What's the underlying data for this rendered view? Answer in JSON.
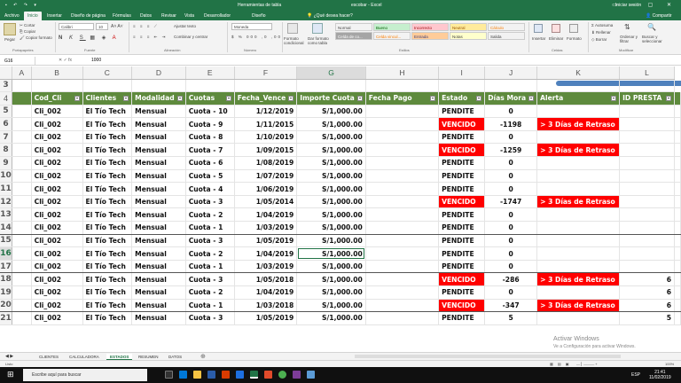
{
  "title_bar": {
    "text1": "Herramientas de tabla",
    "text2": "escobar - Excel",
    "signin": "Iniciar sesión"
  },
  "tabs": [
    "Archivo",
    "Inicio",
    "Insertar",
    "Diseño de página",
    "Fórmulas",
    "Datos",
    "Revisar",
    "Vista",
    "Desarrollador",
    "Diseño"
  ],
  "active_tab": "Inicio",
  "tell_me": "¿Qué desea hacer?",
  "share": "Compartir",
  "ribbon": {
    "clipboard": {
      "paste": "Pegar",
      "cut": "Cortar",
      "copy": "Copiar",
      "format": "Copiar formato",
      "label": "Portapapeles"
    },
    "font": {
      "name": "Calibri",
      "size": "10",
      "label": "Fuente"
    },
    "alignment": {
      "wrap": "Ajustar texto",
      "merge": "Combinar y centrar",
      "label": "Alineación"
    },
    "number": {
      "format": "Moneda",
      "label": "Número"
    },
    "styles": {
      "conditional": "Formato condicional",
      "table": "Dar formato como tabla",
      "cells": [
        {
          "label": "Normal",
          "bg": "#ffffff",
          "color": "#000000"
        },
        {
          "label": "Bueno",
          "bg": "#c6efce",
          "color": "#006100"
        },
        {
          "label": "Incorrecto",
          "bg": "#ffc7ce",
          "color": "#9c0006"
        },
        {
          "label": "Neutral",
          "bg": "#ffeb9c",
          "color": "#9c5700"
        },
        {
          "label": "Cálculo",
          "bg": "#f2f2f2",
          "color": "#fa7d00"
        },
        {
          "label": "Celda de co...",
          "bg": "#a5a5a5",
          "color": "#ffffff"
        },
        {
          "label": "Celda vincul...",
          "bg": "#ffffff",
          "color": "#fa7d00"
        },
        {
          "label": "Entrada",
          "bg": "#ffcc99",
          "color": "#3f3f76"
        },
        {
          "label": "Notas",
          "bg": "#ffffcc",
          "color": "#000000"
        },
        {
          "label": "Salida",
          "bg": "#f2f2f2",
          "color": "#3f3f3f"
        }
      ],
      "label": "Estilos"
    },
    "cells": {
      "insert": "Insertar",
      "delete": "Eliminar",
      "format": "Formato",
      "label": "Celdas"
    },
    "editing": {
      "autosum": "Autosuma",
      "fill": "Rellenar",
      "clear": "Borrar",
      "sort": "Ordenar y filtrar",
      "find": "Buscar y seleccionar",
      "label": "Modificar"
    }
  },
  "formula_bar": {
    "name_box": "G16",
    "value": "1000"
  },
  "columns": [
    "A",
    "B",
    "C",
    "D",
    "E",
    "F",
    "G",
    "H",
    "I",
    "J",
    "K",
    "L"
  ],
  "header_row": {
    "row_num": "4",
    "cells": [
      "",
      "Cod_Cli",
      "Clientes",
      "Modalidad",
      "Cuotas",
      "Fecha_Vence",
      "Importe Cuota",
      "Fecha Pago",
      "Estado",
      "Días Mora",
      "Alerta",
      "ID PRESTA"
    ]
  },
  "rows": [
    {
      "n": "5",
      "cells": [
        "",
        "Cli_002",
        "El Tío Tech",
        "Mensual",
        "Cuota - 10",
        "1/12/2019",
        "S/1,000.00",
        "",
        "PENDITE",
        "0",
        "",
        ""
      ],
      "status": "PENDITE"
    },
    {
      "n": "6",
      "cells": [
        "",
        "Cli_002",
        "El Tío Tech",
        "Mensual",
        "Cuota - 9",
        "1/11/2015",
        "S/1,000.00",
        "",
        "VENCIDO",
        "-1198",
        "> 3 Días de Retraso",
        ""
      ],
      "status": "VENCIDO"
    },
    {
      "n": "7",
      "cells": [
        "",
        "Cli_002",
        "El Tío Tech",
        "Mensual",
        "Cuota - 8",
        "1/10/2019",
        "S/1,000.00",
        "",
        "PENDITE",
        "0",
        "",
        ""
      ],
      "status": "PENDITE"
    },
    {
      "n": "8",
      "cells": [
        "",
        "Cli_002",
        "El Tío Tech",
        "Mensual",
        "Cuota - 7",
        "1/09/2015",
        "S/1,000.00",
        "",
        "VENCIDO",
        "-1259",
        "> 3 Días de Retraso",
        ""
      ],
      "status": "VENCIDO"
    },
    {
      "n": "9",
      "cells": [
        "",
        "Cli_002",
        "El Tío Tech",
        "Mensual",
        "Cuota - 6",
        "1/08/2019",
        "S/1,000.00",
        "",
        "PENDITE",
        "0",
        "",
        ""
      ],
      "status": "PENDITE"
    },
    {
      "n": "10",
      "cells": [
        "",
        "Cli_002",
        "El Tío Tech",
        "Mensual",
        "Cuota - 5",
        "1/07/2019",
        "S/1,000.00",
        "",
        "PENDITE",
        "0",
        "",
        ""
      ],
      "status": "PENDITE"
    },
    {
      "n": "11",
      "cells": [
        "",
        "Cli_002",
        "El Tío Tech",
        "Mensual",
        "Cuota - 4",
        "1/06/2019",
        "S/1,000.00",
        "",
        "PENDITE",
        "0",
        "",
        ""
      ],
      "status": "PENDITE"
    },
    {
      "n": "12",
      "cells": [
        "",
        "Cli_002",
        "El Tío Tech",
        "Mensual",
        "Cuota - 3",
        "1/05/2014",
        "S/1,000.00",
        "",
        "VENCIDO",
        "-1747",
        "> 3 Días de Retraso",
        ""
      ],
      "status": "VENCIDO"
    },
    {
      "n": "13",
      "cells": [
        "",
        "Cli_002",
        "El Tío Tech",
        "Mensual",
        "Cuota - 2",
        "1/04/2019",
        "S/1,000.00",
        "",
        "PENDITE",
        "0",
        "",
        ""
      ],
      "status": "PENDITE"
    },
    {
      "n": "14",
      "cells": [
        "",
        "Cli_002",
        "El Tío Tech",
        "Mensual",
        "Cuota - 1",
        "1/03/2019",
        "S/1,000.00",
        "",
        "PENDITE",
        "0",
        "",
        ""
      ],
      "status": "PENDITE",
      "thick": true
    },
    {
      "n": "15",
      "cells": [
        "",
        "Cli_002",
        "El Tío Tech",
        "Mensual",
        "Cuota - 3",
        "1/05/2019",
        "S/1,000.00",
        "",
        "PENDITE",
        "0",
        "",
        ""
      ],
      "status": "PENDITE"
    },
    {
      "n": "16",
      "cells": [
        "",
        "Cli_002",
        "El Tío Tech",
        "Mensual",
        "Cuota - 2",
        "1/04/2019",
        "S/1,000.00",
        "",
        "PENDITE",
        "0",
        "",
        ""
      ],
      "status": "PENDITE",
      "active": true
    },
    {
      "n": "17",
      "cells": [
        "",
        "Cli_002",
        "El Tío Tech",
        "Mensual",
        "Cuota - 1",
        "1/03/2019",
        "S/1,000.00",
        "",
        "PENDITE",
        "0",
        "",
        ""
      ],
      "status": "PENDITE",
      "thick": true
    },
    {
      "n": "18",
      "cells": [
        "",
        "Cli_002",
        "El Tío Tech",
        "Mensual",
        "Cuota - 3",
        "1/05/2018",
        "S/1,000.00",
        "",
        "VENCIDO",
        "-286",
        "> 3 Días de Retraso",
        "6"
      ],
      "status": "VENCIDO"
    },
    {
      "n": "19",
      "cells": [
        "",
        "Cli_002",
        "El Tío Tech",
        "Mensual",
        "Cuota - 2",
        "1/04/2019",
        "S/1,000.00",
        "",
        "PENDITE",
        "0",
        "",
        "6"
      ],
      "status": "PENDITE"
    },
    {
      "n": "20",
      "cells": [
        "",
        "Cli_002",
        "El Tío Tech",
        "Mensual",
        "Cuota - 1",
        "1/03/2018",
        "S/1,000.00",
        "",
        "VENCIDO",
        "-347",
        "> 3 Días de Retraso",
        "6"
      ],
      "status": "VENCIDO",
      "thick": true
    },
    {
      "n": "21",
      "cells": [
        "",
        "Cli_002",
        "El Tío Tech",
        "Mensual",
        "Cuota - 3",
        "1/05/2019",
        "S/1,000.00",
        "",
        "PENDITE",
        "5",
        "",
        "5"
      ],
      "status": "PENDITE"
    }
  ],
  "sheets": [
    "CLIENTES",
    "CALCULADORA",
    "ESTADOS",
    "RESUMEN",
    "DATOS"
  ],
  "active_sheet": "ESTADOS",
  "status_bar": {
    "mode": "Listo",
    "zoom": "100%"
  },
  "watermark": {
    "line1": "Activar Windows",
    "line2": "Ve a Configuración para activar Windows."
  },
  "taskbar": {
    "search": "Escribe aquí para buscar",
    "time": "21:41",
    "date": "11/02/2019",
    "lang": "ESP"
  },
  "colors": {
    "excel_green": "#217346",
    "header_green": "#5e8a3d",
    "alert_red": "#ff0000"
  }
}
